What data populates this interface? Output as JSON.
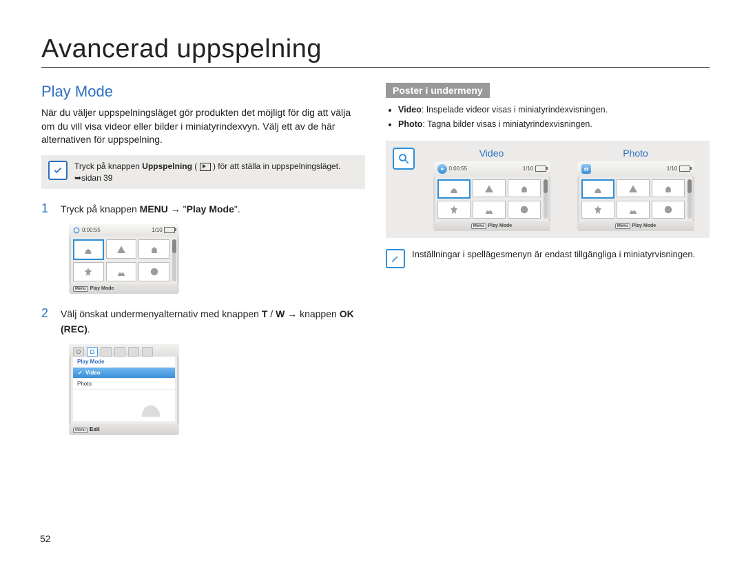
{
  "page": {
    "number": "52",
    "title": "Avancerad uppspelning"
  },
  "left": {
    "heading": "Play Mode",
    "intro": "När du väljer uppspelningsläget gör produkten det möjligt för dig att välja om du vill visa videor eller bilder i miniatyrindexvyn. Välj ett av de här alternativen för uppspelning.",
    "note_pre": "Tryck på knappen ",
    "note_bold": "Uppspelning",
    "note_post1": " ( ",
    "note_post2": " ) för att ställa in uppspelningsläget. ",
    "note_ref": "➥sidan 39",
    "step1_pre": "Tryck på knappen ",
    "step1_b1": "MENU",
    "step1_arrow": " → \"",
    "step1_b2": "Play Mode",
    "step1_end": "\".",
    "step2_pre": "Välj önskat undermenyalternativ med knappen ",
    "step2_b1": "T",
    "step2_slash": " / ",
    "step2_b2": "W",
    "step2_arrow": " → knappen ",
    "step2_b3": "OK (REC)",
    "step2_end": "."
  },
  "screen_a": {
    "time": "0:00:55",
    "counter": "1/10",
    "menu_label": "Menu",
    "bottom_label": "Play Mode"
  },
  "screen_b": {
    "title": "Play Mode",
    "opt1": "Video",
    "opt2": "Photo",
    "menu_label": "Menu",
    "bottom_label": "Exit"
  },
  "right": {
    "submenu_heading": "Poster i undermeny",
    "b1_label": "Video",
    "b1_text": ": Inspelade videor visas i miniatyrindexvisningen.",
    "b2_label": "Photo",
    "b2_text": ": Tagna bilder visas i miniatyrindexvisningen.",
    "mode_video": "Video",
    "mode_photo": "Photo",
    "tip": "Inställningar i spellägesmenyn är endast tillgängliga i miniatyrvisningen."
  },
  "preview": {
    "time": "0:00:55",
    "counter": "1/10",
    "menu_label": "Menu",
    "bottom_label": "Play Mode"
  }
}
